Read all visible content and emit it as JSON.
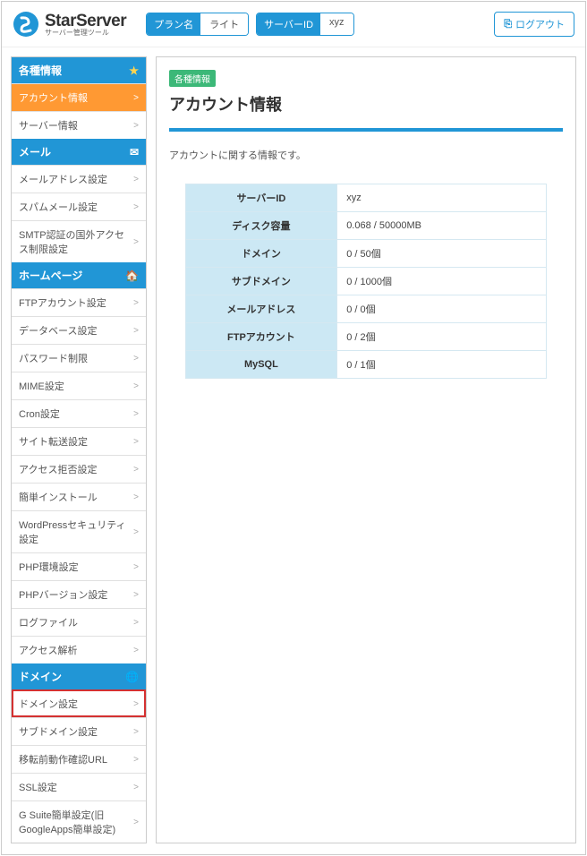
{
  "logo": {
    "main": "StarServer",
    "sub": "サーバー管理ツール"
  },
  "topbar": {
    "plan_label": "プラン名",
    "plan_value": "ライト",
    "server_label": "サーバーID",
    "server_value": "xyz",
    "logout": "ログアウト"
  },
  "sidebar": {
    "sections": [
      {
        "title": "各種情報",
        "icon": "star",
        "items": [
          {
            "label": "アカウント情報",
            "active": true
          },
          {
            "label": "サーバー情報"
          }
        ]
      },
      {
        "title": "メール",
        "icon": "mail",
        "items": [
          {
            "label": "メールアドレス設定"
          },
          {
            "label": "スパムメール設定"
          },
          {
            "label": "SMTP認証の国外アクセス制限設定"
          }
        ]
      },
      {
        "title": "ホームページ",
        "icon": "home",
        "items": [
          {
            "label": "FTPアカウント設定"
          },
          {
            "label": "データベース設定"
          },
          {
            "label": "パスワード制限"
          },
          {
            "label": "MIME設定"
          },
          {
            "label": "Cron設定"
          },
          {
            "label": "サイト転送設定"
          },
          {
            "label": "アクセス拒否設定"
          },
          {
            "label": "簡単インストール"
          },
          {
            "label": "WordPressセキュリティ設定"
          },
          {
            "label": "PHP環境設定"
          },
          {
            "label": "PHPバージョン設定"
          },
          {
            "label": "ログファイル"
          },
          {
            "label": "アクセス解析"
          }
        ]
      },
      {
        "title": "ドメイン",
        "icon": "globe",
        "items": [
          {
            "label": "ドメイン設定",
            "highlight": true
          },
          {
            "label": "サブドメイン設定"
          },
          {
            "label": "移転前動作確認URL"
          },
          {
            "label": "SSL設定"
          },
          {
            "label": "G Suite簡単設定(旧GoogleApps簡単設定)"
          }
        ]
      }
    ]
  },
  "content": {
    "tag": "各種情報",
    "title": "アカウント情報",
    "desc": "アカウントに関する情報です。",
    "rows": [
      {
        "key": "サーバーID",
        "val": "xyz"
      },
      {
        "key": "ディスク容量",
        "val": "0.068 / 50000MB"
      },
      {
        "key": "ドメイン",
        "val": "0 / 50個"
      },
      {
        "key": "サブドメイン",
        "val": "0 / 1000個"
      },
      {
        "key": "メールアドレス",
        "val": "0 / 0個"
      },
      {
        "key": "FTPアカウント",
        "val": "0 / 2個"
      },
      {
        "key": "MySQL",
        "val": "0 / 1個"
      }
    ]
  }
}
